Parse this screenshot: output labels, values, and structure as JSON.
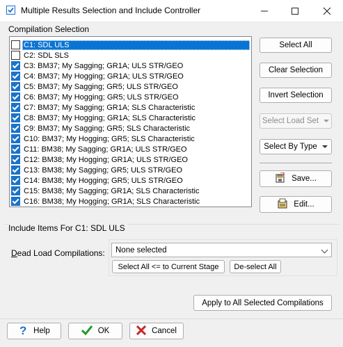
{
  "window": {
    "title": "Multiple Results Selection and Include Controller",
    "minimize_icon": "minimize-icon",
    "maximize_icon": "maximize-icon",
    "close_icon": "close-icon"
  },
  "compilation": {
    "label": "Compilation Selection",
    "items": [
      {
        "label": "C1: SDL ULS",
        "checked": false,
        "selected": true
      },
      {
        "label": "C2: SDL SLS",
        "checked": false,
        "selected": false
      },
      {
        "label": "C3: BM37; My Sagging; GR1A; ULS STR/GEO",
        "checked": true,
        "selected": false
      },
      {
        "label": "C4: BM37; My Hogging; GR1A; ULS STR/GEO",
        "checked": true,
        "selected": false
      },
      {
        "label": "C5: BM37; My Sagging; GR5; ULS STR/GEO",
        "checked": true,
        "selected": false
      },
      {
        "label": "C6: BM37; My Hogging; GR5; ULS STR/GEO",
        "checked": true,
        "selected": false
      },
      {
        "label": "C7: BM37; My Sagging; GR1A; SLS Characteristic",
        "checked": true,
        "selected": false
      },
      {
        "label": "C8: BM37; My Hogging; GR1A; SLS Characteristic",
        "checked": true,
        "selected": false
      },
      {
        "label": "C9: BM37; My Sagging; GR5; SLS Characteristic",
        "checked": true,
        "selected": false
      },
      {
        "label": "C10: BM37; My Hogging; GR5; SLS Characteristic",
        "checked": true,
        "selected": false
      },
      {
        "label": "C11: BM38; My Sagging; GR1A; ULS STR/GEO",
        "checked": true,
        "selected": false
      },
      {
        "label": "C12: BM38; My Hogging; GR1A; ULS STR/GEO",
        "checked": true,
        "selected": false
      },
      {
        "label": "C13: BM38; My Sagging; GR5; ULS STR/GEO",
        "checked": true,
        "selected": false
      },
      {
        "label": "C14: BM38; My Hogging; GR5; ULS STR/GEO",
        "checked": true,
        "selected": false
      },
      {
        "label": "C15: BM38; My Sagging; GR1A; SLS Characteristic",
        "checked": true,
        "selected": false
      },
      {
        "label": "C16: BM38; My Hogging; GR1A; SLS Characteristic",
        "checked": true,
        "selected": false
      }
    ]
  },
  "side_buttons": {
    "select_all": "Select All",
    "clear_selection": "Clear Selection",
    "invert_selection": "Invert Selection",
    "select_load_set": "Select Load Set",
    "select_by_type": "Select By Type",
    "save": "Save...",
    "edit": "Edit..."
  },
  "include": {
    "label": "Include Items For C1: SDL ULS",
    "dead_load_label": "Dead Load Compilations:",
    "dead_load_value": "None selected",
    "select_all_stage": "Select All <= to Current Stage",
    "deselect_all": "De-select All",
    "apply_all": "Apply to All Selected Compilations"
  },
  "footer": {
    "help": "Help",
    "ok": "OK",
    "cancel": "Cancel"
  },
  "colors": {
    "selection": "#0a74d4",
    "checkbox": "#1a73c9",
    "help_icon": "#1a73c9",
    "ok_icon": "#1e9b2c",
    "cancel_icon": "#c62828"
  }
}
